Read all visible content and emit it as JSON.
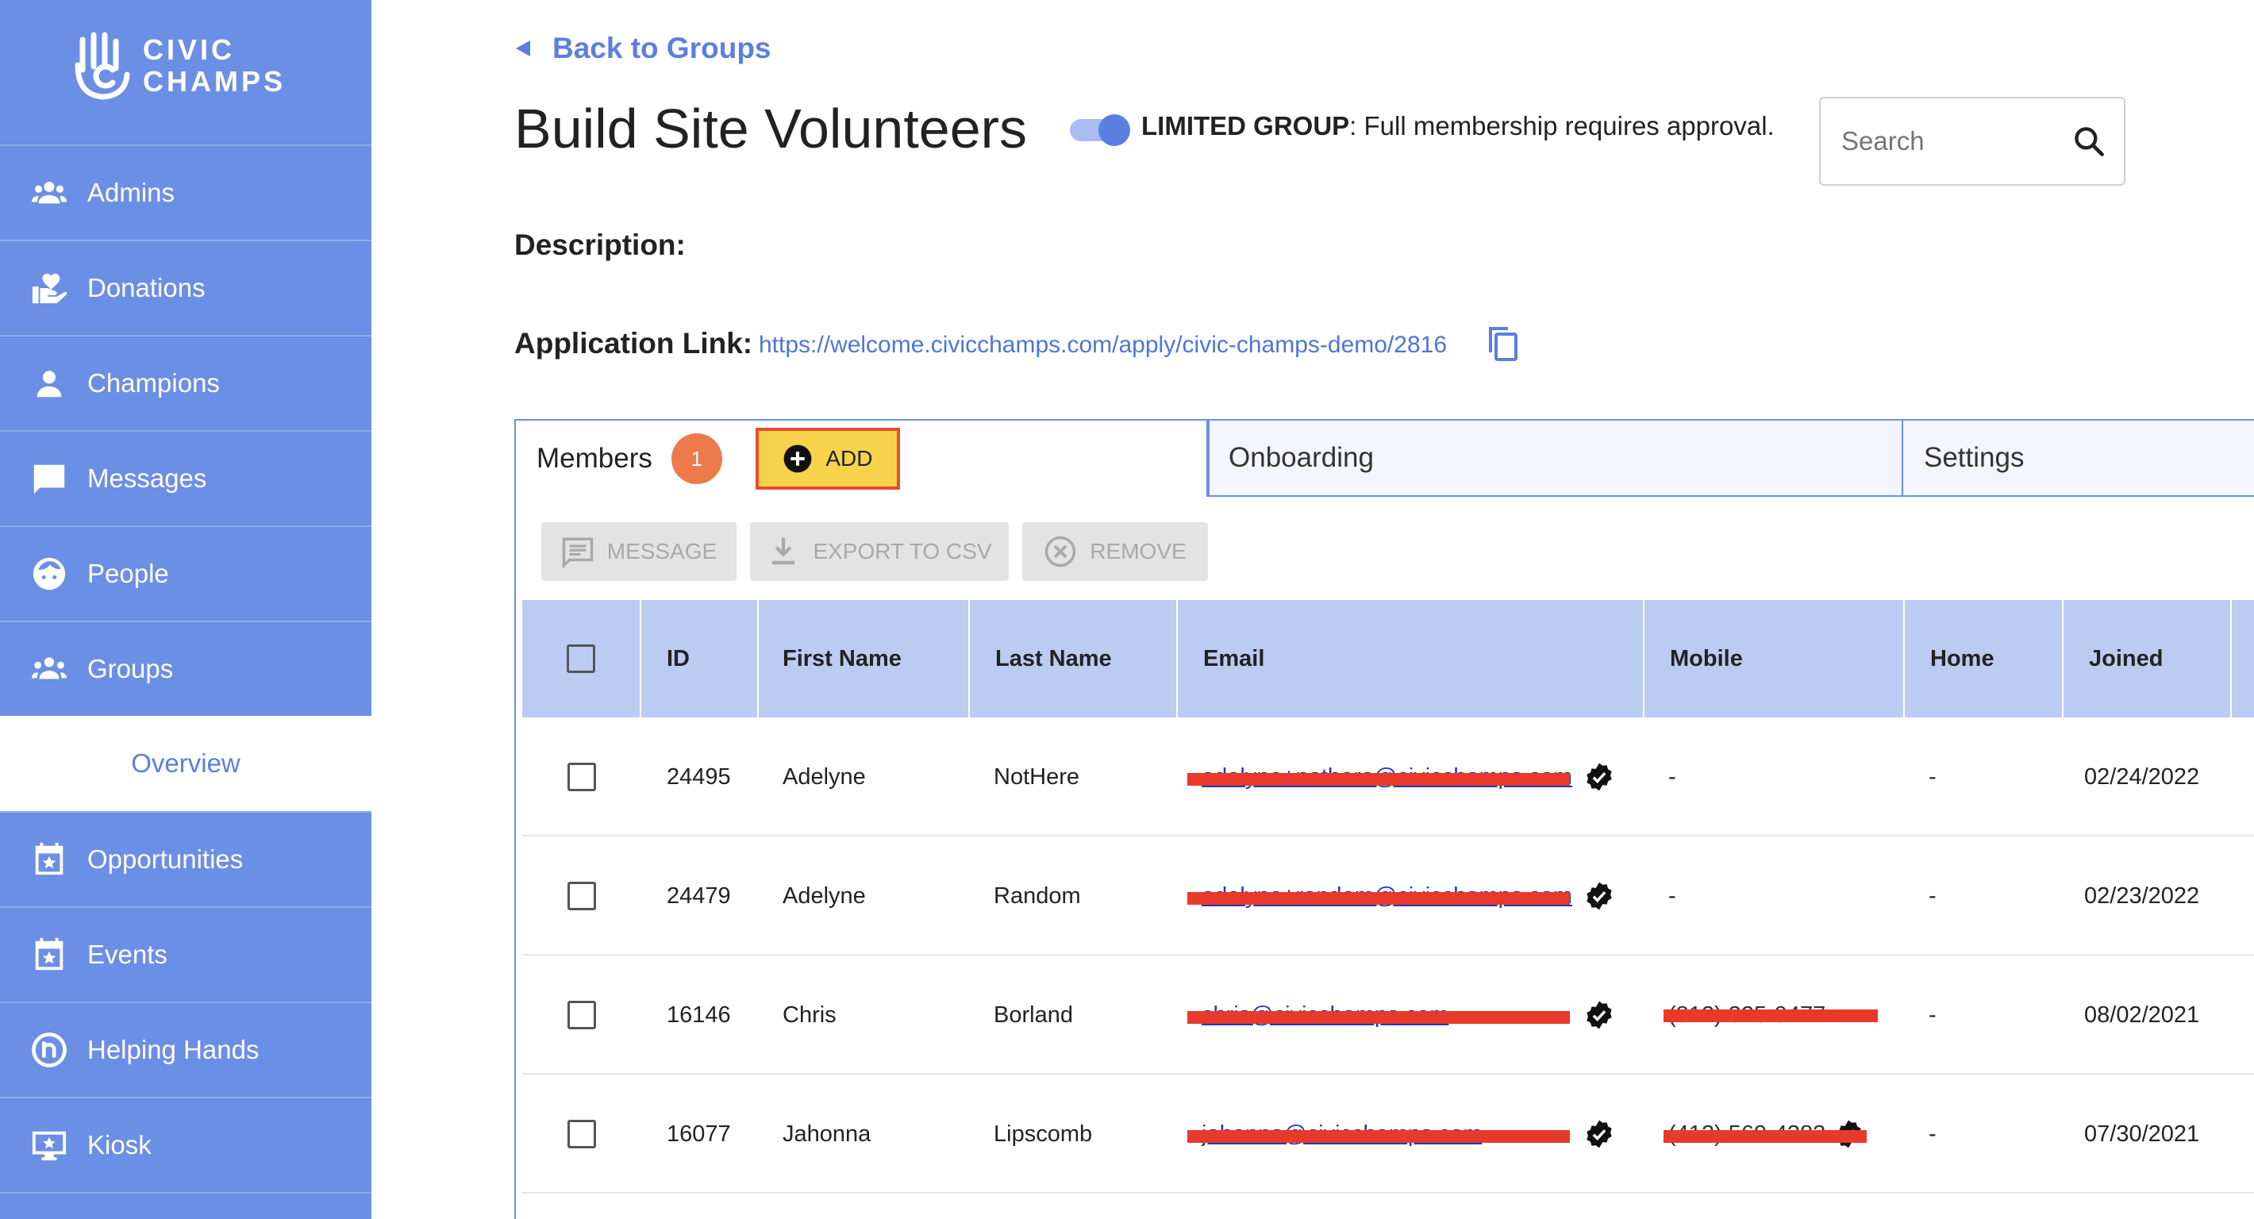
{
  "brand": {
    "line1": "CIVIC",
    "line2": "CHAMPS"
  },
  "sidebar": {
    "items": [
      {
        "label": "Admins",
        "icon": "people-icon"
      },
      {
        "label": "Donations",
        "icon": "donation-hand-icon"
      },
      {
        "label": "Champions",
        "icon": "person-icon"
      },
      {
        "label": "Messages",
        "icon": "chat-icon"
      },
      {
        "label": "People",
        "icon": "face-icon"
      },
      {
        "label": "Groups",
        "icon": "group-icon"
      },
      {
        "label": "Overview",
        "icon": ""
      },
      {
        "label": "Opportunities",
        "icon": "calendar-star-icon"
      },
      {
        "label": "Events",
        "icon": "calendar-star-icon"
      },
      {
        "label": "Helping Hands",
        "icon": "helping-hands-icon"
      },
      {
        "label": "Kiosk",
        "icon": "monitor-star-icon"
      }
    ],
    "selected": "Overview"
  },
  "header": {
    "back_label": "Back to Groups",
    "title": "Build Site Volunteers",
    "limited_bold": "LIMITED GROUP",
    "limited_text": ": Full membership requires approval.",
    "toggle_on": true,
    "search_placeholder": "Search"
  },
  "details": {
    "description_label": "Description:",
    "application_label": "Application Link:",
    "application_url": "https://welcome.civicchamps.com/apply/civic-champs-demo/2816"
  },
  "tabs": {
    "members_label": "Members",
    "members_badge": "1",
    "add_label": "ADD",
    "onboarding_label": "Onboarding",
    "settings_label": "Settings"
  },
  "actions": {
    "message": "MESSAGE",
    "export": "EXPORT TO CSV",
    "remove": "REMOVE"
  },
  "table": {
    "columns": [
      "ID",
      "First Name",
      "Last Name",
      "Email",
      "Mobile",
      "Home",
      "Joined"
    ],
    "rows": [
      {
        "id": "24495",
        "first": "Adelyne",
        "last": "NotHere",
        "email": "adelyne+nothere@civicchamps.com",
        "mobile": "-",
        "home": "-",
        "joined": "02/24/2022"
      },
      {
        "id": "24479",
        "first": "Adelyne",
        "last": "Random",
        "email": "adelyne+random@civicchamps.com",
        "mobile": "-",
        "home": "-",
        "joined": "02/23/2022"
      },
      {
        "id": "16146",
        "first": "Chris",
        "last": "Borland",
        "email": "chris@civicchamps.com",
        "mobile": "(812) 325-9477",
        "home": "-",
        "joined": "08/02/2021"
      },
      {
        "id": "16077",
        "first": "Jahonna",
        "last": "Lipscomb",
        "email": "jahonna@civicchamps.com",
        "mobile": "(412) 569-4383",
        "home": "-",
        "joined": "07/30/2021"
      }
    ]
  },
  "colors": {
    "sidebar": "#6b8fe4",
    "accent": "#5b7fe0",
    "table_header": "#bccbf1",
    "badge": "#ec7a4a",
    "add_button": "#f7d24b",
    "highlight_border": "#ea4b2f",
    "redaction": "#e8392b"
  }
}
